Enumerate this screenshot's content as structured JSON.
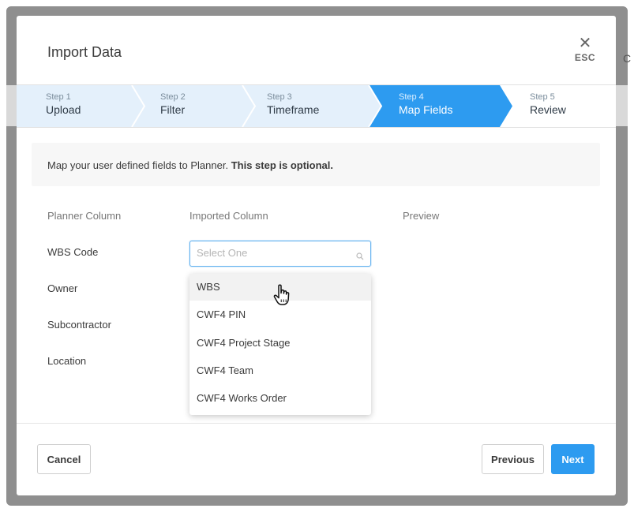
{
  "dialog": {
    "title": "Import Data",
    "close_label": "ESC"
  },
  "steps": [
    {
      "num": "Step 1",
      "label": "Upload"
    },
    {
      "num": "Step 2",
      "label": "Filter"
    },
    {
      "num": "Step 3",
      "label": "Timeframe"
    },
    {
      "num": "Step 4",
      "label": "Map Fields"
    },
    {
      "num": "Step 5",
      "label": "Review"
    }
  ],
  "active_step": 4,
  "info": {
    "text": "Map your user defined fields to Planner.",
    "bold_text": "This step is optional."
  },
  "columns": {
    "planner": "Planner Column",
    "imported": "Imported Column",
    "preview": "Preview"
  },
  "rows": [
    "WBS Code",
    "Owner",
    "Subcontractor",
    "Location"
  ],
  "select": {
    "placeholder": "Select One"
  },
  "dropdown_options": [
    "WBS",
    "CWF4 PIN",
    "CWF4 Project Stage",
    "CWF4 Team",
    "CWF4 Works Order"
  ],
  "highlighted_option": "WBS",
  "footer": {
    "cancel": "Cancel",
    "previous": "Previous",
    "next": "Next"
  },
  "colors": {
    "accent": "#2d9bf0",
    "completed_step": "#e4f0fb"
  },
  "background": {
    "fragment": "C"
  }
}
